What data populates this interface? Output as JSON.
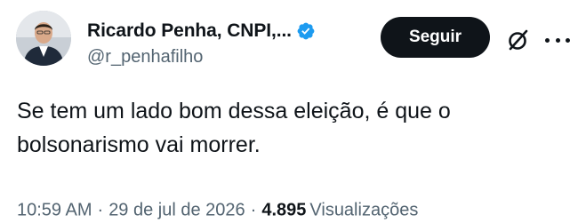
{
  "author": {
    "display_name": "Ricardo Penha, CNPI,...",
    "handle": "@r_penhafilho",
    "verified": true
  },
  "actions": {
    "follow_label": "Seguir"
  },
  "tweet": {
    "text": "Se tem um lado bom dessa eleição, é que o bolsonarismo vai morrer.",
    "time": "10:59 AM",
    "date": "29 de jul de 2026",
    "separator": "·",
    "views_count": "4.895",
    "views_label": "Visualizações"
  },
  "colors": {
    "text_primary": "#0f1419",
    "text_secondary": "#536471",
    "verified_badge": "#1d9bf0",
    "button_bg": "#0f1419",
    "button_text": "#ffffff"
  },
  "icons": {
    "verified": "verified-badge-icon",
    "grok": "grok-icon",
    "more": "more-icon"
  }
}
